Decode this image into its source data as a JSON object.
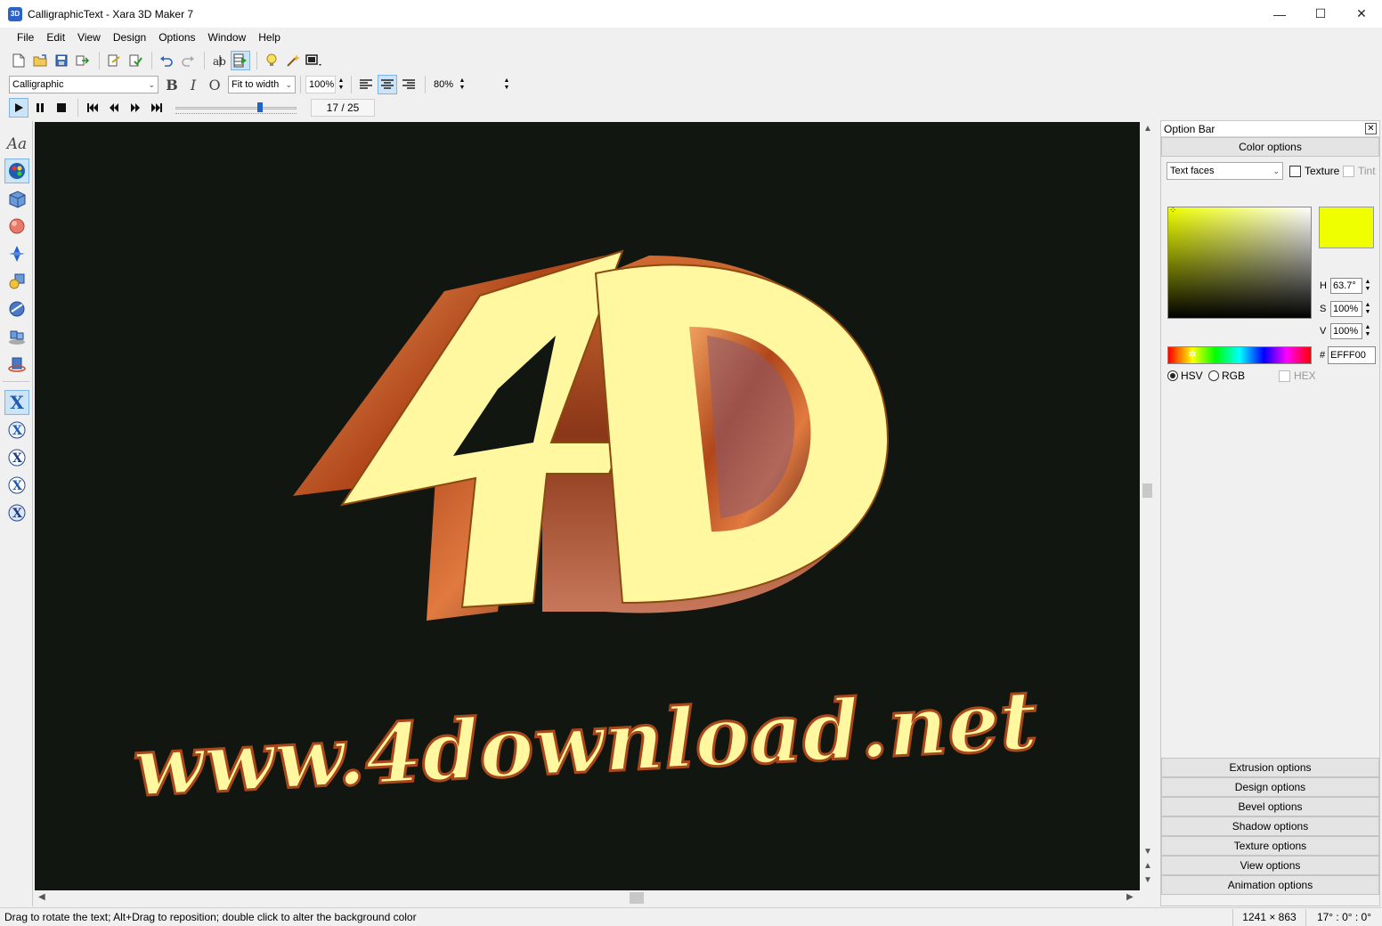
{
  "window": {
    "title": "CalligraphicText - Xara 3D Maker 7",
    "app_icon_text": "3D",
    "minimize": "—",
    "maximize": "☐",
    "close": "✕"
  },
  "menu": {
    "file": "File",
    "edit": "Edit",
    "view": "View",
    "design": "Design",
    "options": "Options",
    "window": "Window",
    "help": "Help"
  },
  "toolbar2": {
    "font": "Calligraphic",
    "fit_mode": "Fit to width",
    "scale": "100%",
    "line_spacing": "80%",
    "bold": "B",
    "italic": "I",
    "outline": "O"
  },
  "playback": {
    "frame_counter": "17 / 25",
    "slider_position": 0.71
  },
  "canvas": {
    "background_color": "#121611",
    "headline_text": "4D",
    "subtitle_text": "www.4download.net"
  },
  "option_bar": {
    "title": "Option Bar",
    "close_label": "✕",
    "color_options_label": "Color options",
    "target_combo": "Text faces",
    "texture_label": "Texture",
    "tint_label": "Tint",
    "h_label": "H",
    "h_value": "63.7°",
    "s_label": "S",
    "s_value": "100%",
    "v_label": "V",
    "v_value": "100%",
    "hex_label": "#",
    "hex_value": "EFFF00",
    "current_color": "#EFFF00",
    "hsv_label": "HSV",
    "rgb_label": "RGB",
    "hex_check_label": "HEX",
    "sections": [
      "Extrusion options",
      "Design options",
      "Bevel options",
      "Shadow options",
      "Texture options",
      "View options",
      "Animation options"
    ]
  },
  "status": {
    "message": "Drag to rotate the text; Alt+Drag to reposition; double click to alter the background color",
    "dimensions": "1241 × 863",
    "rotation": "17° : 0° : 0°"
  }
}
